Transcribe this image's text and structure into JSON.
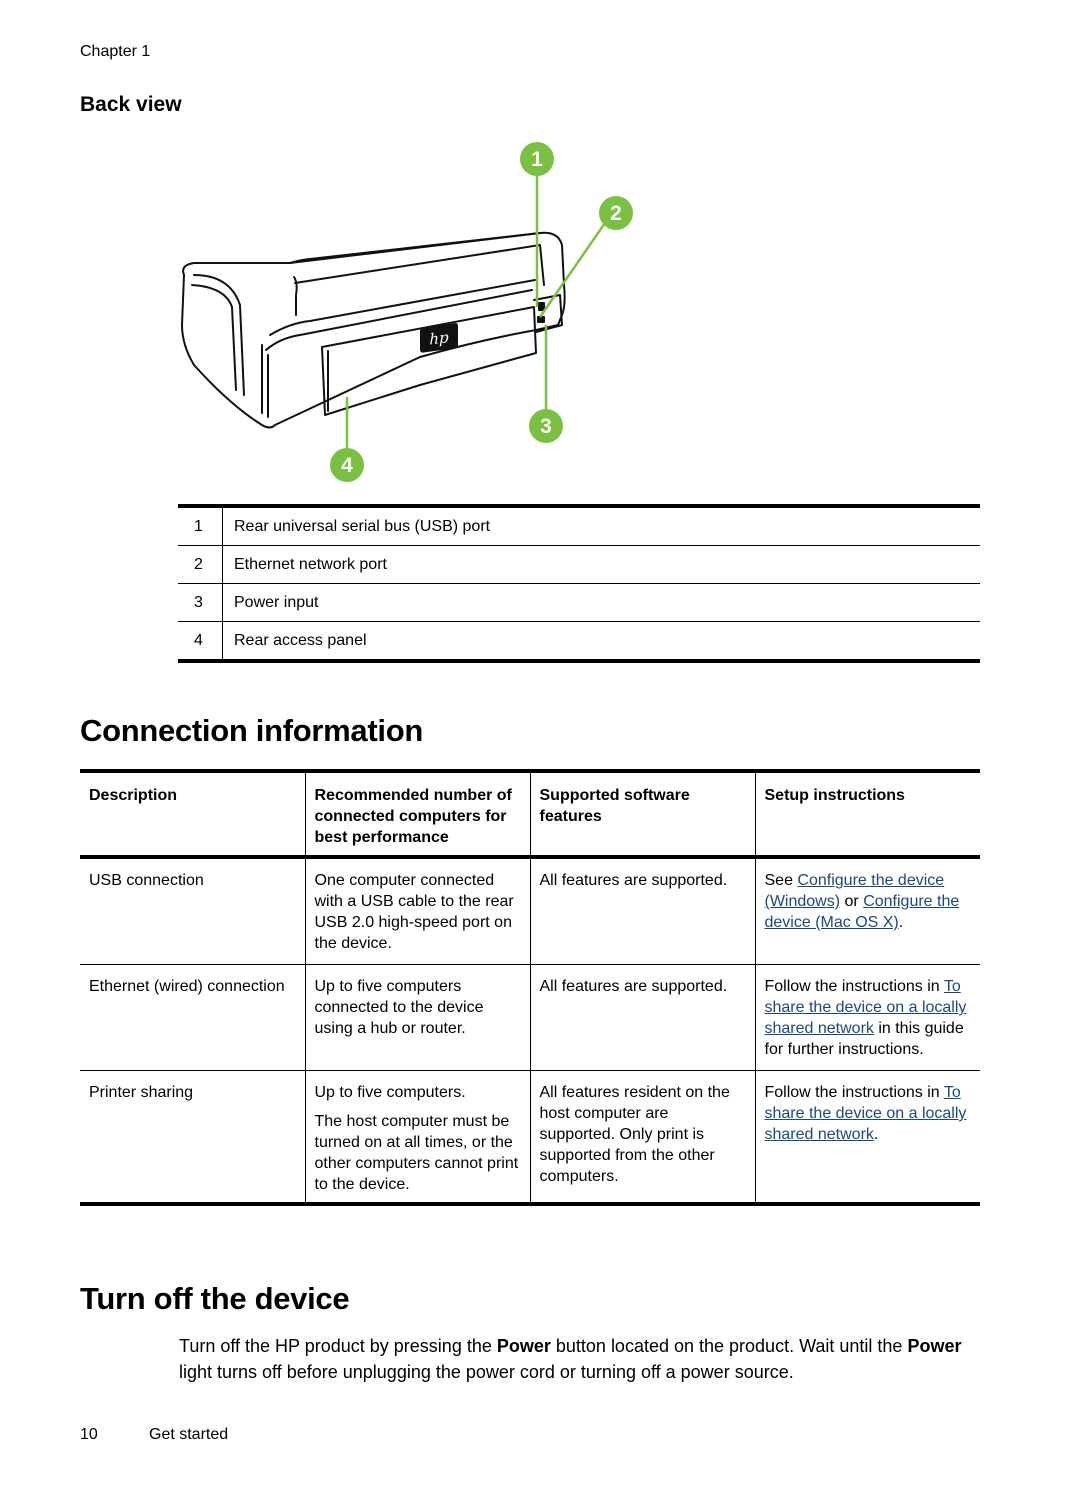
{
  "header": {
    "chapter": "Chapter 1"
  },
  "back_view": {
    "title": "Back view",
    "figure": {
      "callouts": [
        "1",
        "2",
        "3",
        "4"
      ],
      "logo_text": "hp",
      "callout_color": "#7ac143"
    },
    "legend": [
      {
        "num": "1",
        "label": "Rear universal serial bus (USB) port"
      },
      {
        "num": "2",
        "label": "Ethernet network port"
      },
      {
        "num": "3",
        "label": "Power input"
      },
      {
        "num": "4",
        "label": "Rear access panel"
      }
    ]
  },
  "connection_information": {
    "title": "Connection information",
    "columns": [
      "Description",
      "Recommended number of connected computers for best performance",
      "Supported software features",
      "Setup instructions"
    ],
    "rows": [
      {
        "description": "USB connection",
        "recommended": [
          "One computer connected with a USB cable to the rear USB 2.0 high-speed port on the device."
        ],
        "features": "All features are supported.",
        "setup": {
          "prefix": "See ",
          "link1": "Configure the device (Windows)",
          "middle": " or ",
          "link2": "Configure the device (Mac OS X)",
          "suffix": "."
        }
      },
      {
        "description": "Ethernet (wired) connection",
        "recommended": [
          "Up to five computers connected to the device using a hub or router."
        ],
        "features": "All features are supported.",
        "setup": {
          "prefix": "Follow the instructions in ",
          "link1": "To share the device on a locally shared network",
          "suffix": " in this guide for further instructions."
        }
      },
      {
        "description": "Printer sharing",
        "recommended": [
          "Up to five computers.",
          "The host computer must be turned on at all times, or the other computers cannot print to the device."
        ],
        "features": "All features resident on the host computer are supported. Only print is supported from the other computers.",
        "setup": {
          "prefix": "Follow the instructions in ",
          "link1": "To share the device on a locally shared network",
          "suffix": "."
        }
      }
    ]
  },
  "turn_off": {
    "title": "Turn off the device",
    "para": {
      "t1": "Turn off the HP product by pressing the ",
      "b1": "Power",
      "t2": " button located on the product. Wait until the ",
      "b2": "Power",
      "t3": " light turns off before unplugging the power cord or turning off a power source."
    }
  },
  "footer": {
    "page_number": "10",
    "section": "Get started"
  },
  "colors": {
    "link": "#1b4a7a",
    "callout": "#7ac143",
    "text": "#000000"
  }
}
